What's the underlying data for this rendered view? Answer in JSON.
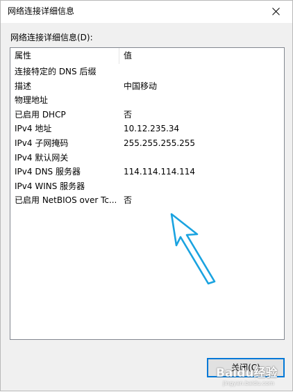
{
  "window": {
    "title": "网络连接详细信息",
    "close_glyph": "✕"
  },
  "details": {
    "label": "网络连接详细信息(D):",
    "columns": {
      "property": "属性",
      "value": "值"
    },
    "rows": [
      {
        "property": "连接特定的 DNS 后缀",
        "value": ""
      },
      {
        "property": "描述",
        "value": "中国移动"
      },
      {
        "property": "物理地址",
        "value": ""
      },
      {
        "property": "已启用 DHCP",
        "value": "否"
      },
      {
        "property": "IPv4 地址",
        "value": "10.12.235.34"
      },
      {
        "property": "IPv4 子网掩码",
        "value": "255.255.255.255"
      },
      {
        "property": "IPv4 默认网关",
        "value": ""
      },
      {
        "property": "IPv4 DNS 服务器",
        "value": "114.114.114.114"
      },
      {
        "property": "IPv4 WINS 服务器",
        "value": ""
      },
      {
        "property": "已启用 NetBIOS over Tc...",
        "value": "否"
      }
    ]
  },
  "footer": {
    "close_label": "关闭(C)"
  },
  "annotation": {
    "arrow_color": "#1aa3e0",
    "icon": "arrow-pointing-up-left-icon"
  },
  "watermark": {
    "text": "Baidu经验",
    "url": "jingyan.baidu.com"
  }
}
